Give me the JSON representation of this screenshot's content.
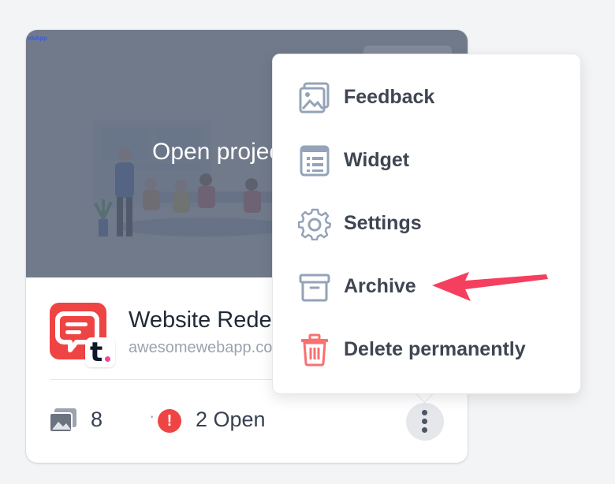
{
  "thumbnail": {
    "brand_text": "ebApp",
    "open_label": "Open project"
  },
  "project": {
    "name": "Website Redesign",
    "url": "awesomewebapp.com",
    "image_count": "8",
    "separator": "·",
    "alert_symbol": "!",
    "open_issues": "2 Open",
    "badge_letter": "t"
  },
  "menu": {
    "items": [
      {
        "label": "Feedback",
        "icon": "feedback-image-icon"
      },
      {
        "label": "Widget",
        "icon": "widget-icon"
      },
      {
        "label": "Settings",
        "icon": "gear-icon"
      },
      {
        "label": "Archive",
        "icon": "archive-box-icon"
      },
      {
        "label": "Delete permanently",
        "icon": "trash-icon"
      }
    ]
  },
  "colors": {
    "accent_red": "#ef4444",
    "annotation_arrow": "#f43f5e",
    "icon_gray": "#94a3b8",
    "text_dark": "#3f4652"
  }
}
